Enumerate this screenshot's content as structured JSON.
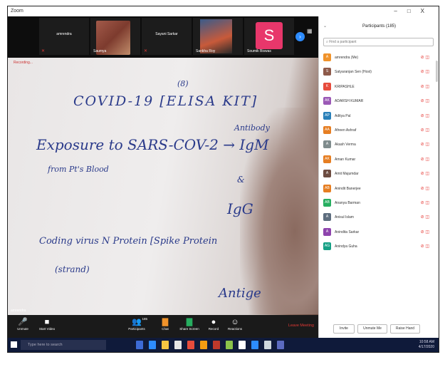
{
  "window": {
    "title": "Zoom",
    "buttons": [
      "–",
      "□",
      "X"
    ]
  },
  "strip": {
    "tiles": [
      {
        "name": "amrendra",
        "display_name": "amrendra"
      },
      {
        "name": "Saumya"
      },
      {
        "name": "Sayani Sarkar",
        "display_name": "Sayani Sarkar"
      },
      {
        "name": "Sankha Roy"
      },
      {
        "name": "Soumik Biswas",
        "initial": "S"
      }
    ]
  },
  "main": {
    "recording": "Recording..."
  },
  "handwriting": {
    "line1": "COVID-19  [ELISA KIT]",
    "line1b": "Antibody",
    "line2": "Exposure to  SARS-COV-2 → IgM",
    "line2b": "from Pt's Blood",
    "line3": "&",
    "line4": "IgG",
    "line5": "Coding virus N Protein [Spike Protein",
    "line6": "(strand)",
    "line7": "Antige",
    "number": "(8)"
  },
  "controls": {
    "unmute": "Unmute",
    "start_video": "Start Video",
    "participants": "Participants",
    "participants_count": "185",
    "chat": "Chat",
    "share_screen": "Share Screen",
    "record": "Record",
    "reactions": "Reactions",
    "leave": "Leave Meeting",
    "speaker_label": "amrendra"
  },
  "participants_panel": {
    "title": "Participants (185)",
    "search_placeholder": "Find a participant",
    "items": [
      {
        "name": "amrendra (Me)",
        "initials": "A",
        "color": "#f0932b"
      },
      {
        "name": "Satyaranjan Sen (Host)",
        "initials": "S",
        "color": "#8e5a4a"
      },
      {
        "name": "KRIPASHLE",
        "initials": "K",
        "color": "#e74c3c"
      },
      {
        "name": "ADARSH KUMAR",
        "initials": "AK",
        "color": "#9b59b6"
      },
      {
        "name": "Aditya Pal",
        "initials": "AP",
        "color": "#2980b9"
      },
      {
        "name": "Afreen Ashraf",
        "initials": "AA",
        "color": "#e67e22"
      },
      {
        "name": "Akash Verma",
        "initials": "A",
        "color": "#7f8c8d"
      },
      {
        "name": "Aman Kumar",
        "initials": "AK",
        "color": "#e67e22"
      },
      {
        "name": "Amit Majumdar",
        "initials": "A",
        "color": "#6d4c41"
      },
      {
        "name": "Anindit Banerjee",
        "initials": "AB",
        "color": "#e67e22"
      },
      {
        "name": "Ananya Barman",
        "initials": "AB",
        "color": "#27ae60"
      },
      {
        "name": "Anisul Islam",
        "initials": "A",
        "color": "#5d6d7e"
      },
      {
        "name": "Anindita Sarkar",
        "initials": "A",
        "color": "#8e44ad"
      },
      {
        "name": "Anindya Guha",
        "initials": "AG",
        "color": "#16a085"
      }
    ],
    "footer": {
      "invite": "Invite",
      "unmute_me": "Unmute Me",
      "raise_hand": "Raise Hand"
    }
  },
  "taskbar": {
    "search": "Type here to search",
    "time": "10:58 AM",
    "date": "4/17/2020"
  }
}
